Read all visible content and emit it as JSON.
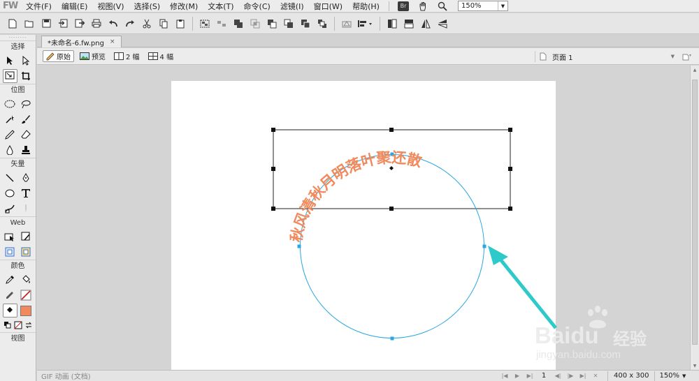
{
  "app": {
    "logo_text": "FW"
  },
  "menu": {
    "items": [
      "文件(F)",
      "编辑(E)",
      "视图(V)",
      "选择(S)",
      "修改(M)",
      "文本(T)",
      "命令(C)",
      "滤镜(I)",
      "窗口(W)",
      "帮助(H)"
    ],
    "bridge_badge": "Br",
    "zoom_value": "150%"
  },
  "tools": {
    "grip": "········",
    "sections": [
      "选择",
      "位图",
      "矢量",
      "Web",
      "颜色",
      "视图"
    ],
    "stroke_color": "#cc2222",
    "fill_color": "#f08a5d"
  },
  "document": {
    "tab_title": "*未命名-6.fw.png",
    "tab_close": "×",
    "views": [
      "原始",
      "预览",
      "2 幅",
      "4 幅"
    ],
    "page_label": "页面 1"
  },
  "canvas_content": {
    "arc_text": "秋风清秋月明落叶聚还散",
    "text_color": "#f08a5d",
    "circle_color": "#29a8e0",
    "arrow_color": "#2ec9c9"
  },
  "status": {
    "left_text": "GIF 动画 (文档)",
    "frame": "1",
    "canvas_size": "400 x 300",
    "zoom": "150%"
  },
  "watermark": {
    "brand": "Baidu",
    "brand_cn": "经验",
    "url": "jingyan.baidu.com"
  }
}
